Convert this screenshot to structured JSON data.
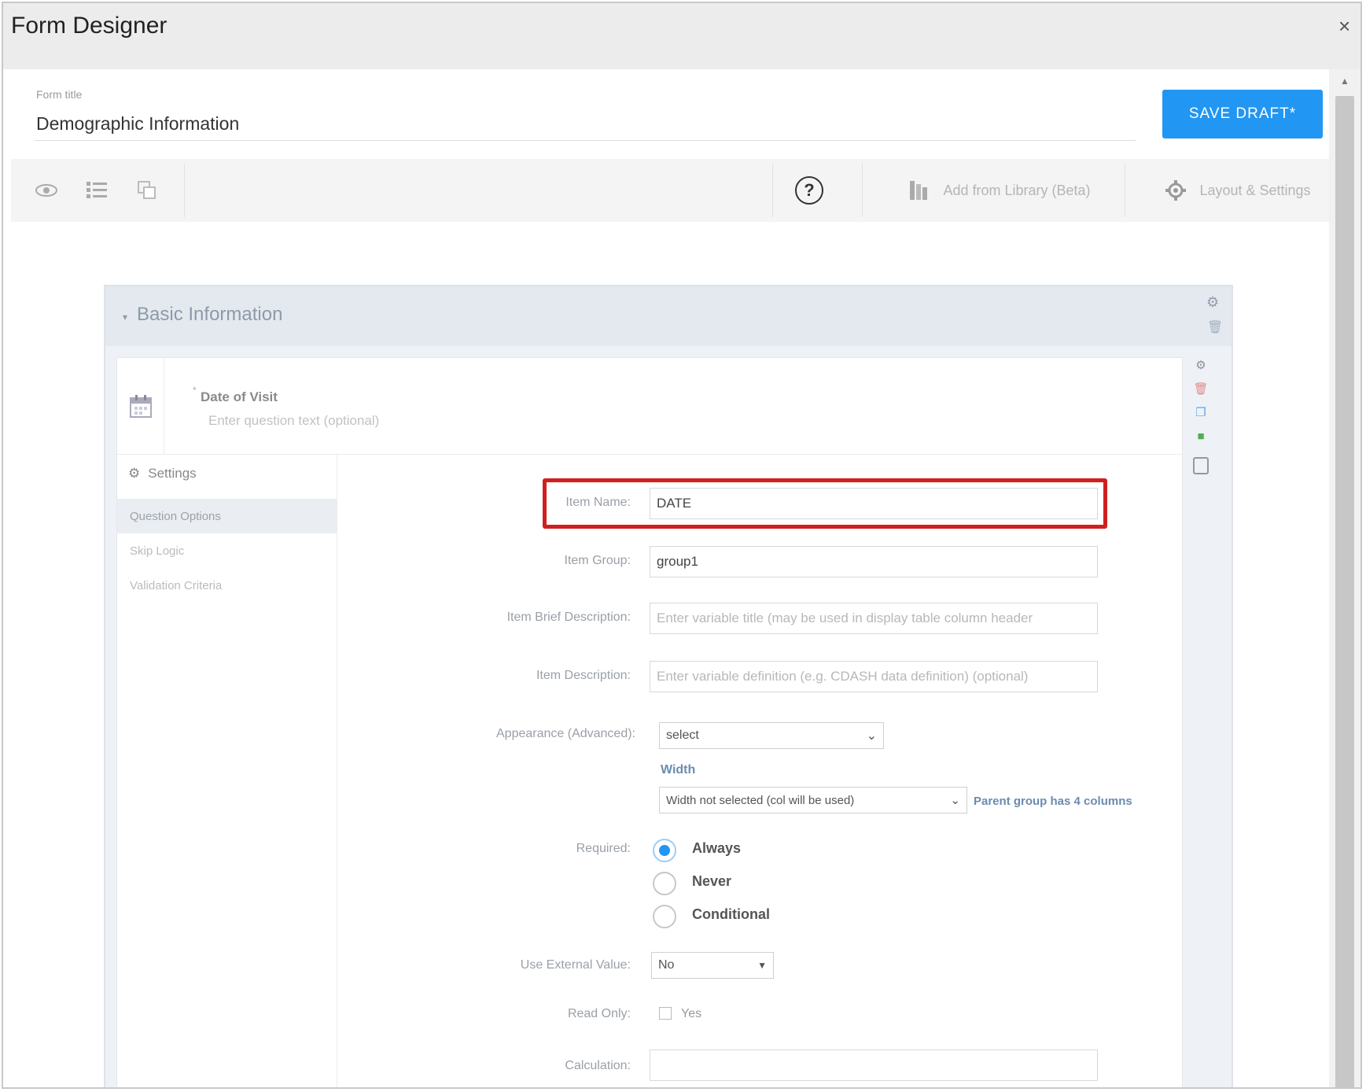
{
  "window": {
    "title": "Form Designer",
    "close_glyph": "×"
  },
  "form": {
    "title_label": "Form title",
    "title_value": "Demographic Information",
    "save_label": "SAVE DRAFT*"
  },
  "toolbar": {
    "help_glyph": "?",
    "add_library_label": "Add from Library (Beta)",
    "layout_settings_label": "Layout & Settings",
    "icons": [
      "eye-icon",
      "list-icon",
      "copy-icon",
      "help-icon",
      "library-icon",
      "gear-icon"
    ]
  },
  "section": {
    "title": "Basic Information"
  },
  "question": {
    "required_mark": "*",
    "label": "Date of Visit",
    "placeholder": "Enter question text (optional)",
    "icon": "calendar-icon"
  },
  "settings_nav": {
    "header": "Settings",
    "items": [
      "Question Options",
      "Skip Logic",
      "Validation Criteria"
    ]
  },
  "fields": {
    "item_name": {
      "label": "Item Name:",
      "value": "DATE"
    },
    "item_group": {
      "label": "Item Group:",
      "value": "group1"
    },
    "item_brief": {
      "label": "Item Brief Description:",
      "placeholder": "Enter variable title (may be used in display table column header"
    },
    "item_description": {
      "label": "Item Description:",
      "placeholder": "Enter variable definition (e.g. CDASH data definition) (optional)"
    },
    "appearance": {
      "label": "Appearance (Advanced):",
      "value": "select"
    },
    "width": {
      "label": "Width",
      "value": "Width not selected (col will be used)",
      "note": "Parent group has 4 columns"
    },
    "required": {
      "label": "Required:",
      "options": [
        "Always",
        "Never",
        "Conditional"
      ],
      "selected": "Always"
    },
    "external_value": {
      "label": "Use External Value:",
      "value": "No"
    },
    "read_only": {
      "label": "Read Only:",
      "option": "Yes",
      "checked": false
    },
    "calculation": {
      "label": "Calculation:",
      "value": ""
    }
  },
  "colors": {
    "accent": "#2196f3",
    "highlight": "#d11f1f"
  }
}
